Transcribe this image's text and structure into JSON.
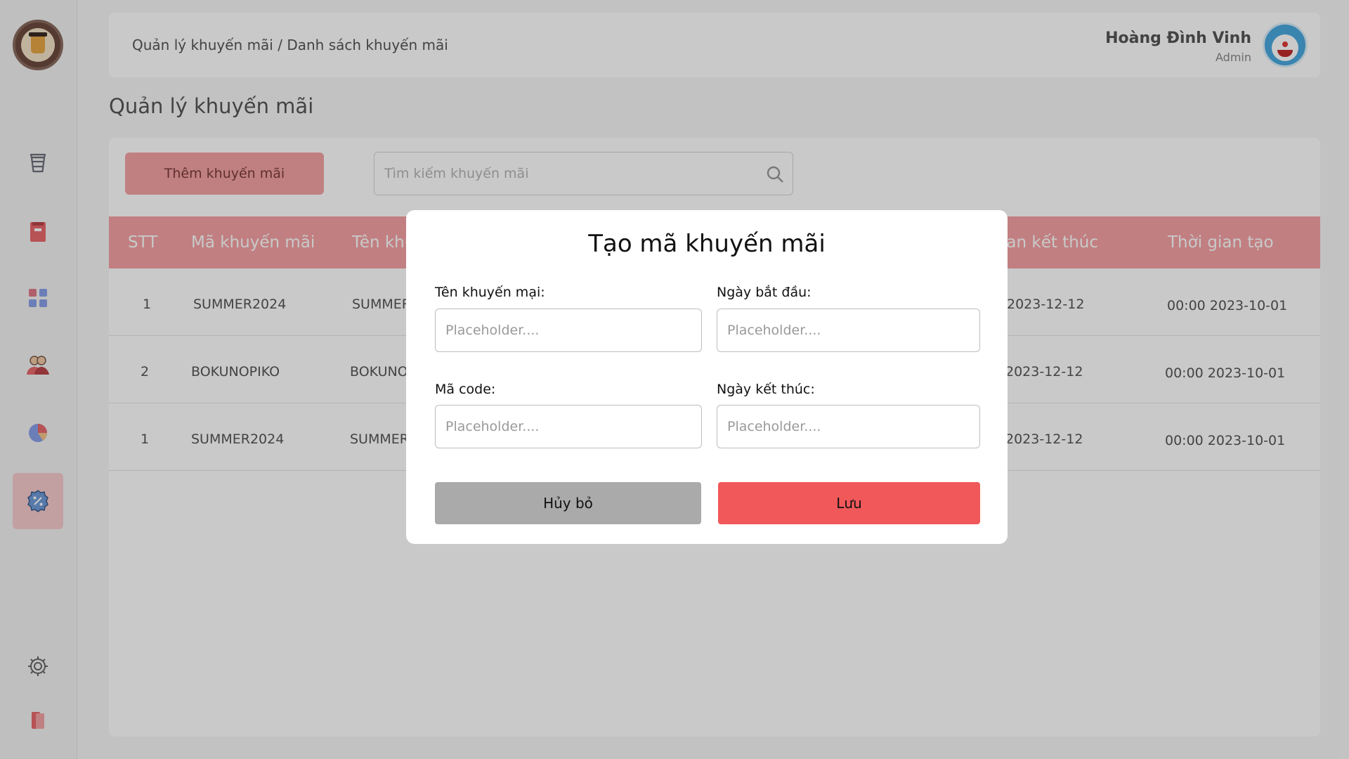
{
  "header": {
    "breadcrumb_parent": "Quản lý khuyến mãi",
    "breadcrumb_sep": "/",
    "breadcrumb_current": "Danh sách khuyến mãi",
    "user_name": "Hoàng Đình Vinh",
    "user_role": "Admin"
  },
  "page_title": "Quản lý khuyến mãi",
  "toolbar": {
    "add_label": "Thêm khuyến mãi",
    "search_placeholder": "Tìm kiếm khuyến mãi"
  },
  "sidebar": {
    "items": [
      {
        "icon": "coffee-cup-icon"
      },
      {
        "icon": "book-icon"
      },
      {
        "icon": "grid-icon"
      },
      {
        "icon": "users-icon"
      },
      {
        "icon": "pie-chart-icon"
      },
      {
        "icon": "discount-badge-icon",
        "active": true
      }
    ],
    "bottom": [
      {
        "icon": "gear-icon"
      },
      {
        "icon": "logout-icon"
      }
    ]
  },
  "table": {
    "headers": [
      "STT",
      "Mã khuyến mãi",
      "Tên khuyến mãi",
      "Thời gian kết thúc",
      "Thời gian tạo"
    ],
    "rows": [
      {
        "stt": "1",
        "code": "SUMMER2024",
        "name": "SUMMER2024",
        "end": "2023-12-12",
        "created": "00:00 2023-10-01"
      },
      {
        "stt": "2",
        "code": "BOKUNOPIKO",
        "name": "BOKUNOPIKO",
        "end": "2023-12-12",
        "created": "00:00 2023-10-01"
      },
      {
        "stt": "1",
        "code": "SUMMER2024",
        "name": "SUMMER2024",
        "end": "2023-12-12",
        "created": "00:00 2023-10-01"
      }
    ]
  },
  "modal": {
    "title": "Tạo mã khuyến mãi",
    "name_label": "Tên khuyến mại:",
    "start_label": "Ngày bắt đầu:",
    "code_label": "Mã code:",
    "end_label": "Ngày kết thúc:",
    "placeholder": "Placeholder....",
    "cancel_label": "Hủy bỏ",
    "save_label": "Lưu"
  },
  "colors": {
    "accent": "#f4a3a5",
    "save": "#f0585a",
    "cancel": "#aaaaaa"
  }
}
